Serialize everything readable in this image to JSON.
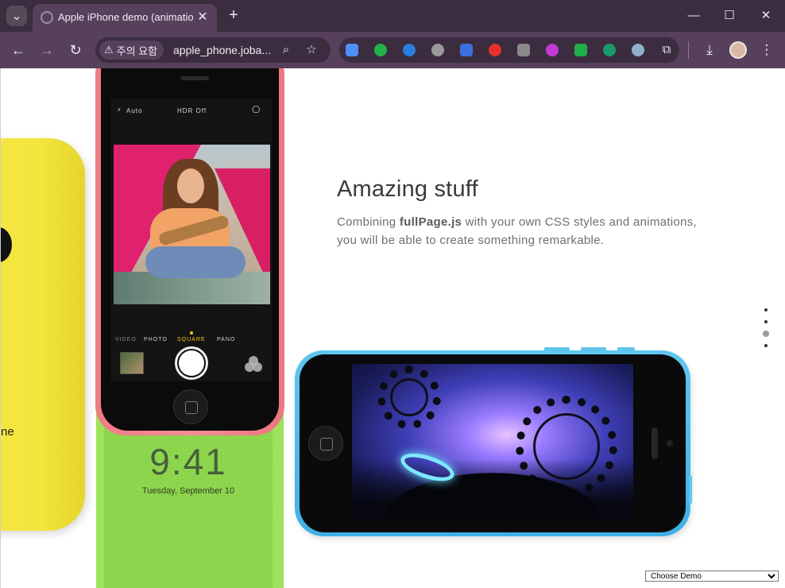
{
  "browser": {
    "tab_title": "Apple iPhone demo (animations)",
    "security_label": "주의 요함",
    "url": "apple_phone.joba...",
    "window_controls": {
      "minimize": "—",
      "maximize": "☐",
      "close": "✕"
    },
    "icons": {
      "tab_search": "chevron-down-icon",
      "new_tab": "plus-icon",
      "back": "back-arrow-icon",
      "forward": "forward-arrow-icon",
      "reload": "reload-icon",
      "zoom": "zoom-icon",
      "bookmark": "star-icon",
      "downloads": "download-icon",
      "menu": "kebab-menu-icon",
      "extensions": "puzzle-icon"
    },
    "extension_colors": [
      "#4f8ff7",
      "#21b24a",
      "#2a7de1",
      "#9a9a9a",
      "#3b6fe0",
      "#e4312b",
      "#8a8a8a",
      "#c23bd4",
      "#1fae4a",
      "#1a9a6c",
      "#8fb0c8"
    ]
  },
  "page": {
    "section_title": "Amazing stuff",
    "body_prefix": "Combining ",
    "body_bold": "fullPage.js",
    "body_suffix": " with your own CSS styles and animations, you will be able to create something remarkable.",
    "yellow_phone_text": "ne",
    "lock_screen": {
      "time": "9:41",
      "date": "Tuesday, September 10"
    },
    "camera": {
      "flash": "Auto",
      "hdr": "HDR Off",
      "modes": [
        "VIDEO",
        "PHOTO",
        "SQUARE",
        "PANO"
      ],
      "active_mode": "SQUARE"
    },
    "fp_nav": {
      "count": 4,
      "active_index": 2
    },
    "demo_select": {
      "selected": "Choose Demo"
    }
  }
}
